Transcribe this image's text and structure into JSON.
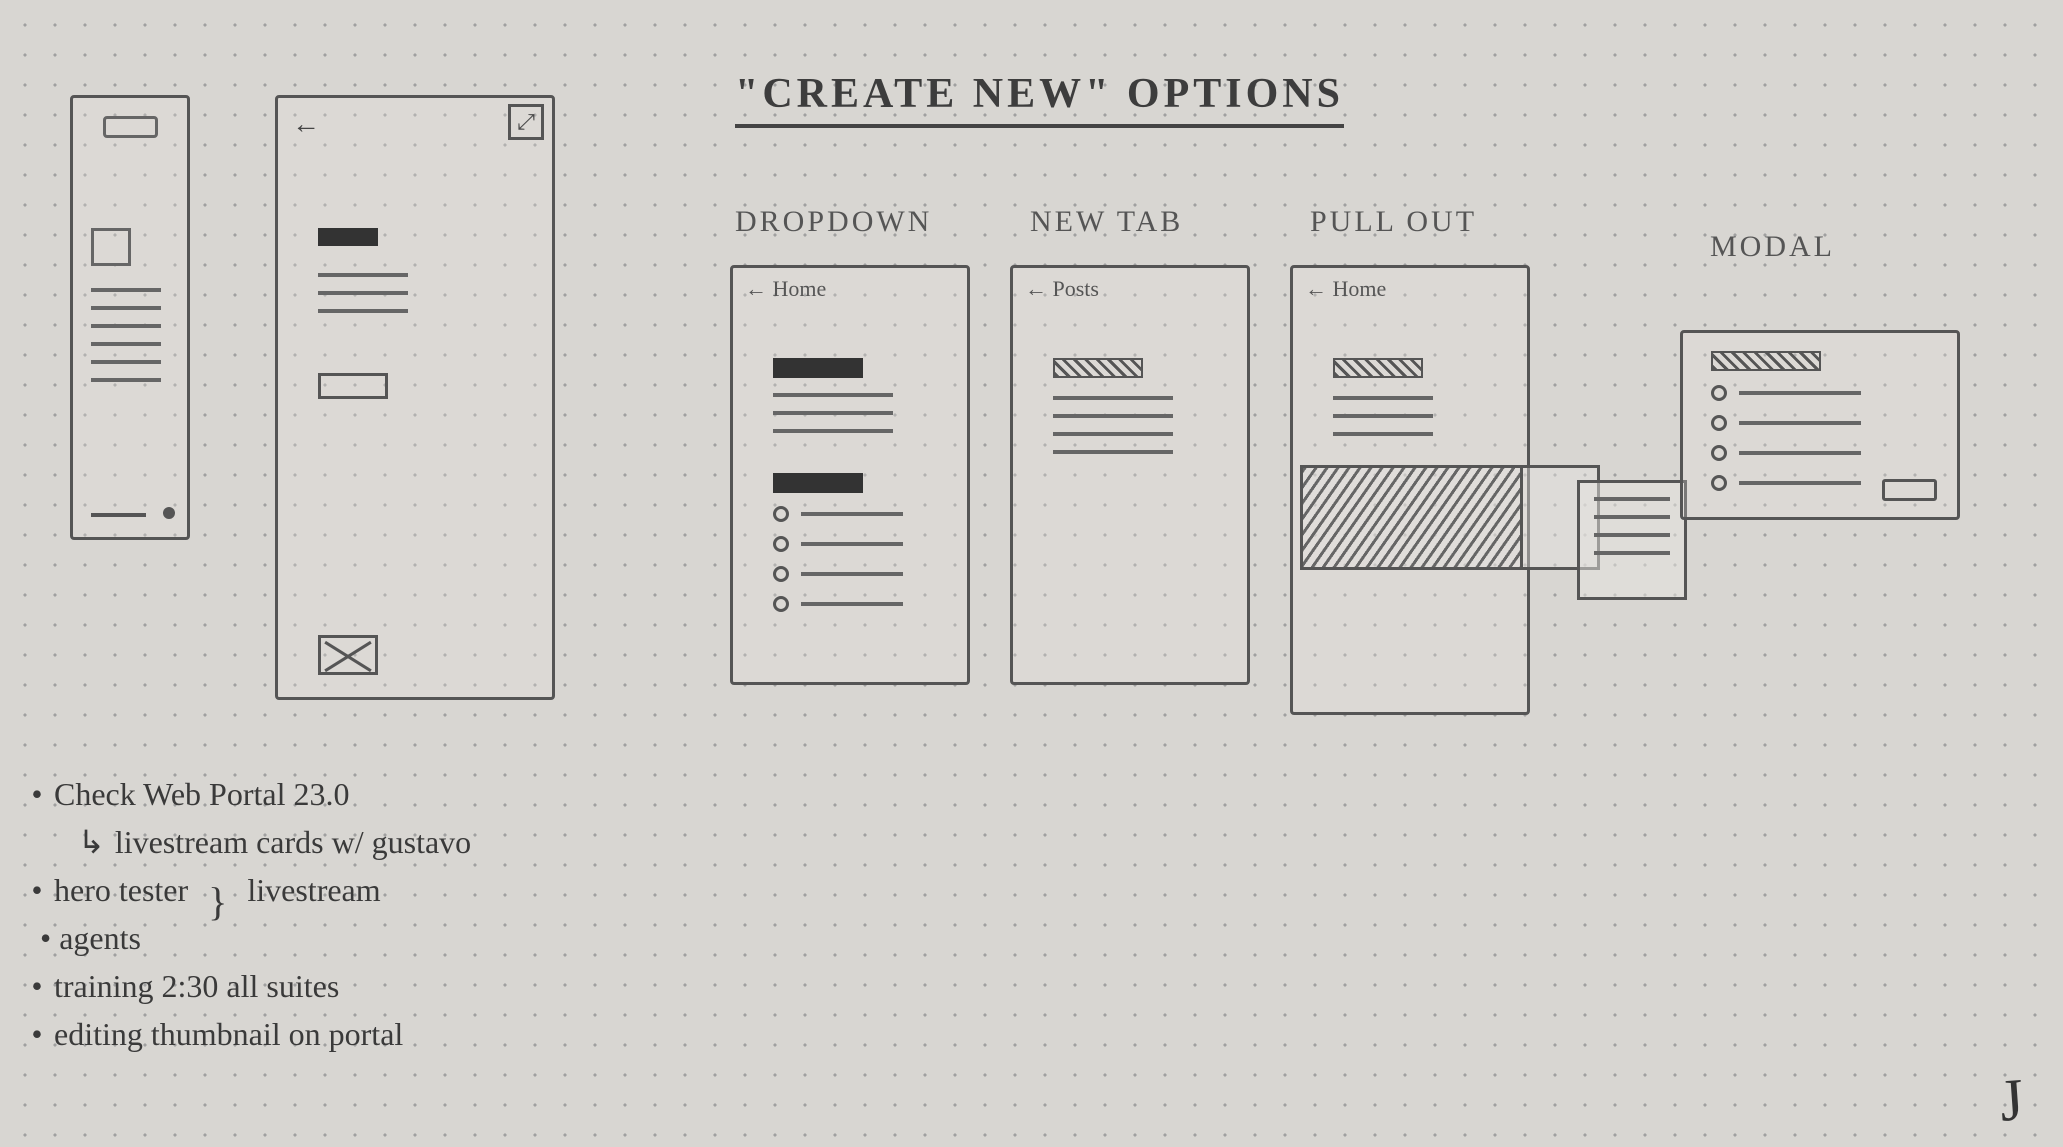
{
  "heading": "\"Create New\" options",
  "options": {
    "dropdown": {
      "label": "Dropdown",
      "back": "← Home"
    },
    "newtab": {
      "label": "New Tab",
      "back": "← Posts"
    },
    "pullout": {
      "label": "Pull out",
      "back": "← Home"
    },
    "modal": {
      "label": "Modal"
    }
  },
  "notes": {
    "l1": "Check Web Portal 23.0",
    "l1_sub": "livestream cards w/ gustavo",
    "l2a": "hero tester",
    "l2b": "agents",
    "l2_right": "livestream",
    "l3": "training 2:30 all suites",
    "l4": "editing thumbnail on portal"
  },
  "stray_mark": "J"
}
